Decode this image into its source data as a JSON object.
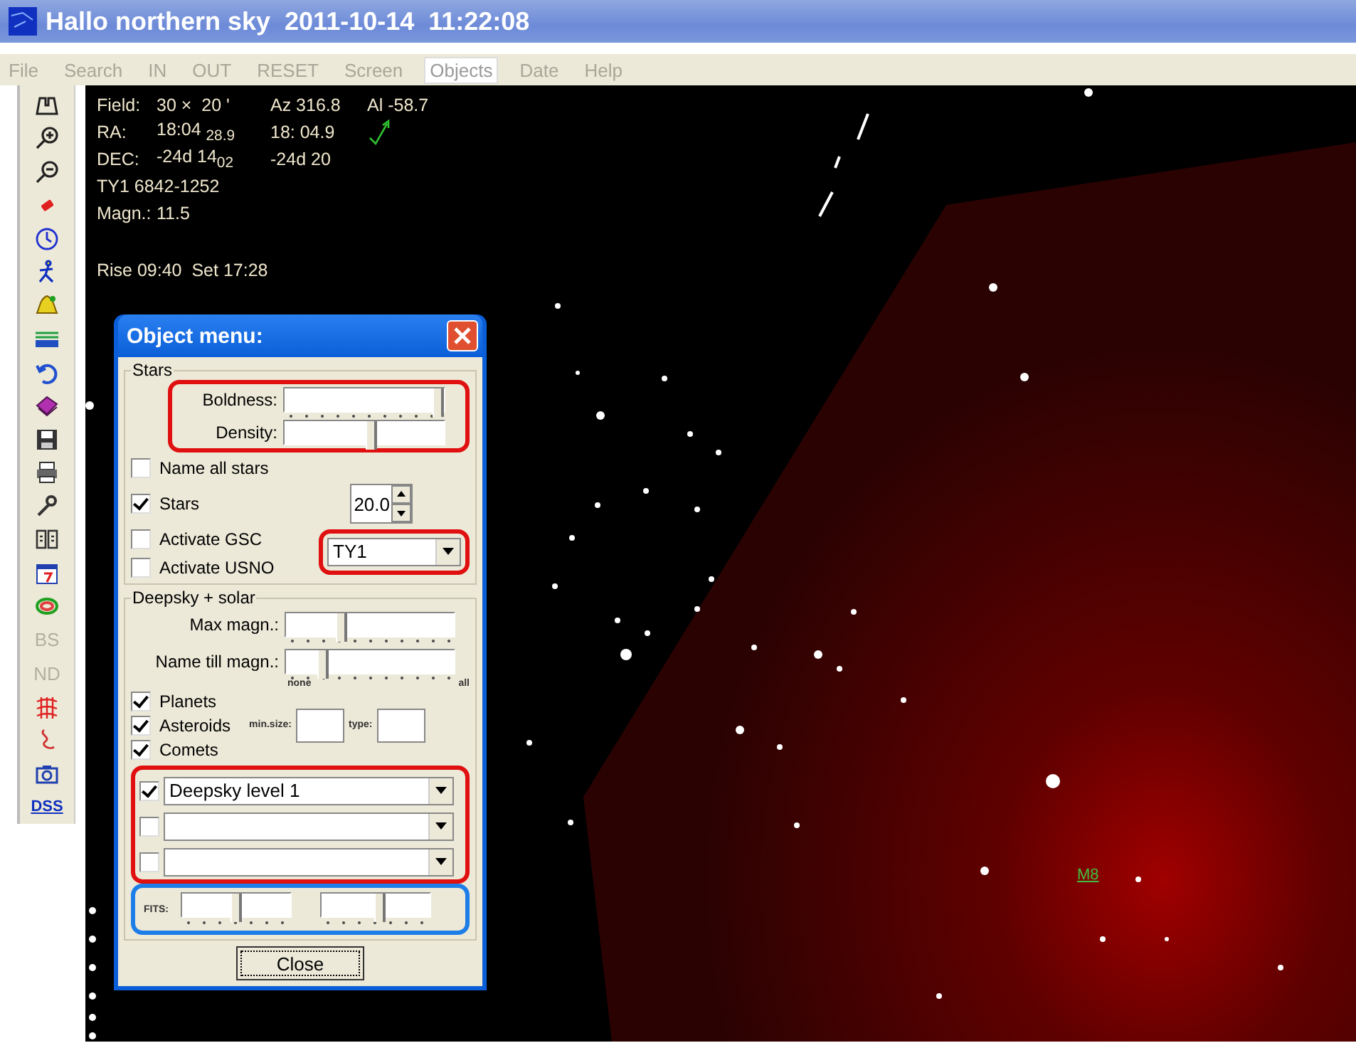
{
  "window": {
    "title": "Hallo northern sky  2011-10-14  11:22:08"
  },
  "menu": [
    {
      "label": "File",
      "selected": false
    },
    {
      "label": "Search",
      "selected": false
    },
    {
      "label": "IN",
      "selected": false
    },
    {
      "label": "OUT",
      "selected": false
    },
    {
      "label": "RESET",
      "selected": false
    },
    {
      "label": "Screen",
      "selected": false
    },
    {
      "label": "Objects",
      "selected": true
    },
    {
      "label": "Date",
      "selected": false
    },
    {
      "label": "Help",
      "selected": false
    }
  ],
  "toolbar": [
    {
      "kind": "icon"
    },
    {
      "kind": "icon"
    },
    {
      "kind": "icon"
    },
    {
      "kind": "icon"
    },
    {
      "kind": "icon"
    },
    {
      "kind": "icon"
    },
    {
      "kind": "icon"
    },
    {
      "kind": "icon"
    },
    {
      "kind": "icon"
    },
    {
      "kind": "icon"
    },
    {
      "kind": "icon"
    },
    {
      "kind": "icon"
    },
    {
      "kind": "icon"
    },
    {
      "kind": "icon"
    },
    {
      "kind": "icon"
    },
    {
      "kind": "icon"
    },
    {
      "kind": "text",
      "label": "BS",
      "disabled": true
    },
    {
      "kind": "text",
      "label": "ND",
      "disabled": true
    },
    {
      "kind": "icon"
    },
    {
      "kind": "icon"
    },
    {
      "kind": "icon"
    },
    {
      "kind": "link",
      "label": "DSS",
      "disabled": false
    }
  ],
  "info": {
    "rows": [
      [
        "Field:",
        "30 ×  20 '",
        "Az 316.8",
        "Al -58.7"
      ],
      [
        "RA:",
        "18:04 $_{28.9}$",
        "18: 04.9"
      ],
      [
        "DEC:",
        "-24d 14$_{02}$",
        "-24d 20"
      ],
      [
        "TY1 6842-1252"
      ],
      [
        "Magn.:",
        "11.5"
      ]
    ],
    "rise_set": "Rise 09:40  Set 17:28"
  },
  "sky_label": "M8",
  "dialog": {
    "title": "Object menu:",
    "stars": {
      "title": "Stars",
      "sliders": [
        {
          "label": "Boldness:",
          "level": 1.0
        },
        {
          "label": "Density:",
          "level": 0.55
        }
      ],
      "name_all": {
        "label": "Name all stars",
        "checked": false
      },
      "stars_check": {
        "label": "Stars",
        "checked": true
      },
      "stars_value": "20.0",
      "gsc": {
        "label": "Activate GSC",
        "checked": false
      },
      "usno": {
        "label": "Activate USNO",
        "checked": false
      },
      "catalog": "TY1"
    },
    "deepsky": {
      "title": "Deepsky + solar",
      "sliders": [
        {
          "label": "Max magn.:",
          "level": 0.32
        },
        {
          "label": "Name till magn.:",
          "level": 0.2
        }
      ],
      "scale_min": "none",
      "scale_max": "all",
      "checks": [
        {
          "label": "Planets",
          "checked": true
        },
        {
          "label": "Asteroids",
          "checked": true
        },
        {
          "label": "Comets",
          "checked": true
        }
      ],
      "min_size_label": "min.size:",
      "type_label": "type:",
      "levels": [
        {
          "checked": true,
          "value": "Deepsky level 1"
        },
        {
          "checked": false
        },
        {
          "checked": false
        }
      ],
      "fits_label": "FITS:",
      "fits": [
        {
          "level": 0.5
        },
        {
          "level": 0.55
        }
      ]
    },
    "close": "Close"
  }
}
